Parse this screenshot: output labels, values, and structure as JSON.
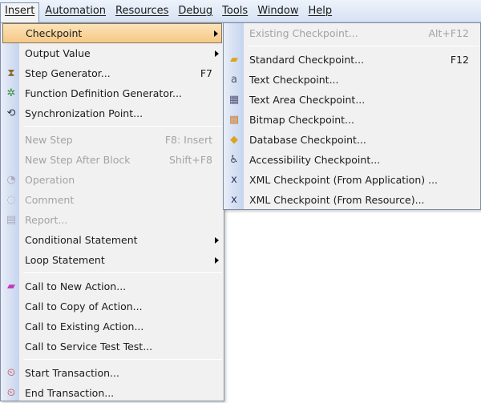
{
  "menubar": [
    "Insert",
    "Automation",
    "Resources",
    "Debug",
    "Tools",
    "Window",
    "Help"
  ],
  "main_menu": [
    {
      "label": "Checkpoint",
      "submenu": true,
      "highlighted": true
    },
    {
      "label": "Output Value",
      "submenu": true
    },
    {
      "label": "Step Generator...",
      "shortcut": "F7",
      "icon": "step-generator-icon"
    },
    {
      "label": "Function Definition Generator...",
      "icon": "function-generator-icon"
    },
    {
      "label": "Synchronization Point...",
      "icon": "synchronization-icon"
    },
    {
      "separator": true
    },
    {
      "label": "New Step",
      "shortcut": "F8: Insert",
      "disabled": true
    },
    {
      "label": "New Step After Block",
      "shortcut": "Shift+F8",
      "disabled": true
    },
    {
      "label": "Operation",
      "disabled": true,
      "icon": "operation-icon"
    },
    {
      "label": "Comment",
      "disabled": true,
      "icon": "comment-icon"
    },
    {
      "label": "Report...",
      "disabled": true,
      "icon": "report-icon"
    },
    {
      "label": "Conditional Statement",
      "submenu": true
    },
    {
      "label": "Loop Statement",
      "submenu": true
    },
    {
      "separator": true
    },
    {
      "label": "Call to New Action...",
      "icon": "new-action-icon"
    },
    {
      "label": "Call to Copy of Action..."
    },
    {
      "label": "Call to Existing Action..."
    },
    {
      "label": "Call to Service Test Test..."
    },
    {
      "separator": true
    },
    {
      "label": "Start Transaction...",
      "icon": "start-transaction-icon"
    },
    {
      "label": "End Transaction...",
      "icon": "end-transaction-icon"
    }
  ],
  "sub_menu": [
    {
      "label": "Existing Checkpoint...",
      "shortcut": "Alt+F12",
      "disabled": true
    },
    {
      "separator": true
    },
    {
      "label": "Standard Checkpoint...",
      "shortcut": "F12",
      "icon": "standard-checkpoint-icon"
    },
    {
      "label": "Text Checkpoint...",
      "icon": "text-checkpoint-icon"
    },
    {
      "label": "Text Area Checkpoint...",
      "icon": "text-area-checkpoint-icon"
    },
    {
      "label": "Bitmap Checkpoint...",
      "icon": "bitmap-checkpoint-icon"
    },
    {
      "label": "Database Checkpoint...",
      "icon": "database-checkpoint-icon"
    },
    {
      "label": "Accessibility Checkpoint...",
      "icon": "accessibility-checkpoint-icon"
    },
    {
      "label": "XML Checkpoint (From Application) ...",
      "icon": "xml-app-checkpoint-icon"
    },
    {
      "label": "XML Checkpoint (From Resource)...",
      "icon": "xml-resource-checkpoint-icon"
    }
  ]
}
